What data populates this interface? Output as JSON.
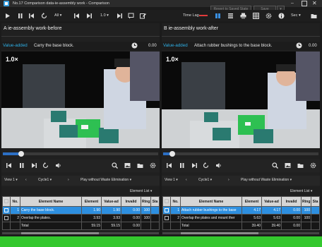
{
  "window": {
    "title": "No.17 Comparison data-ie-assembly work - Comparison"
  },
  "title_actions": {
    "revert_label": "Revert to Saved State",
    "save_label": "Save"
  },
  "toolbar": {
    "all_label": "All",
    "speed_label": "1.0",
    "time_lag_label": "Time Lag",
    "sec_label": "Sec"
  },
  "panel_a": {
    "header": "A  ie-assembly work-before",
    "value_label": "Value-added",
    "element_name": "Carry the base block.",
    "time": "0.00",
    "speed": "1.0×",
    "progress": 0.12
  },
  "panel_b": {
    "header": "B  ie-assembly work-after",
    "value_label": "Value-added",
    "element_name": "Attach rubber bushings to the base block.",
    "time": "0.00",
    "speed": "1.0×",
    "progress": 0.06
  },
  "viewbar": {
    "view": "View 1",
    "cycle": "Cycle1",
    "play_mode": "Play without Waste Elimination",
    "element_list": "Element List"
  },
  "columns": [
    "No.",
    "Element Name",
    "Element",
    "Value-ad",
    "Invalid",
    "Rtng",
    "Sta"
  ],
  "table_a": {
    "rows": [
      {
        "no": "1",
        "name": "Carry the base block.",
        "element": "1.90",
        "value_added": "1.90",
        "invalid": "0.00",
        "rtng": "100",
        "selected": true
      },
      {
        "no": "2",
        "name": "Overlap the plates.",
        "element": "3.93",
        "value_added": "3.93",
        "invalid": "0.00",
        "rtng": "100",
        "selected": false
      }
    ],
    "total": {
      "label": "Total",
      "element": "59.15",
      "value_added": "59.15",
      "invalid": "0.00"
    }
  },
  "table_b": {
    "rows": [
      {
        "no": "1",
        "name": "Attach rubber bushings to the base",
        "element": "4.17",
        "value_added": "4.17",
        "invalid": "0.00",
        "rtng": "100",
        "selected": true
      },
      {
        "no": "2",
        "name": "Overlap the plates and mount ther",
        "element": "5.63",
        "value_added": "5.63",
        "invalid": "0.00",
        "rtng": "100",
        "selected": false
      }
    ],
    "total": {
      "label": "Total",
      "element": "39.40",
      "value_added": "39.40",
      "invalid": "0.00"
    }
  },
  "colors": {
    "accent": "#2d8fe0",
    "value_added": "#2fb0e6",
    "status_bar": "#34c82e",
    "time_lag_value": "#e23b3b"
  }
}
